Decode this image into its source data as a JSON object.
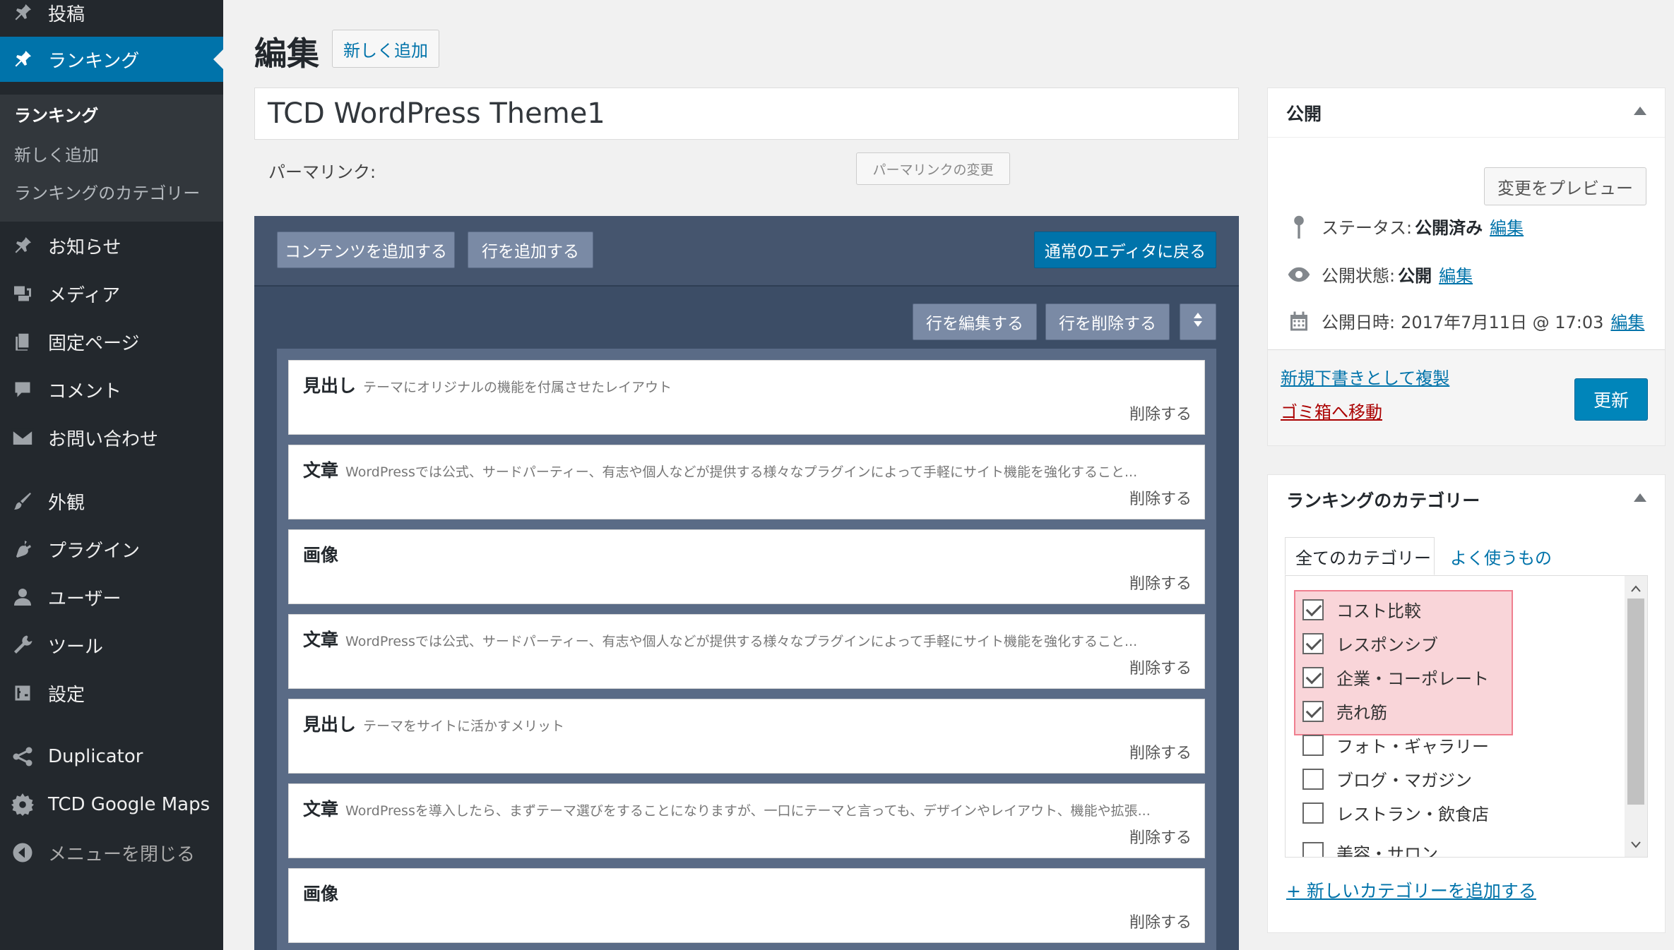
{
  "sidebar": {
    "items": [
      {
        "label": "投稿",
        "icon": "pin-icon"
      },
      {
        "label": "ランキング",
        "icon": "pin-icon"
      },
      {
        "label": "お知らせ",
        "icon": "pin-icon"
      },
      {
        "label": "メディア",
        "icon": "media-icon"
      },
      {
        "label": "固定ページ",
        "icon": "page-icon"
      },
      {
        "label": "コメント",
        "icon": "comment-icon"
      },
      {
        "label": "お問い合わせ",
        "icon": "mail-icon"
      },
      {
        "label": "外観",
        "icon": "brush-icon"
      },
      {
        "label": "プラグイン",
        "icon": "plug-icon"
      },
      {
        "label": "ユーザー",
        "icon": "user-icon"
      },
      {
        "label": "ツール",
        "icon": "wrench-icon"
      },
      {
        "label": "設定",
        "icon": "settings-icon"
      },
      {
        "label": "Duplicator",
        "icon": "share-icon"
      },
      {
        "label": "TCD Google Maps",
        "icon": "gear-icon"
      },
      {
        "label": "メニューを閉じる",
        "icon": "collapse-icon"
      }
    ],
    "submenu": [
      "ランキング",
      "新しく追加",
      "ランキングのカテゴリー"
    ]
  },
  "header": {
    "title": "編集",
    "add_new": "新しく追加"
  },
  "post": {
    "title": "TCD WordPress Theme1",
    "permalink_label": "パーマリンク:",
    "permalink_button": "パーマリンクの変更"
  },
  "builder": {
    "add_content": "コンテンツを追加する",
    "add_row": "行を追加する",
    "back_to_editor": "通常のエディタに戻る",
    "edit_row": "行を編集する",
    "delete_row": "行を削除する",
    "delete_label": "削除する",
    "rows": [
      {
        "type": "見出し",
        "desc": "テーマにオリジナルの機能を付属させたレイアウト"
      },
      {
        "type": "文章",
        "desc": "WordPressでは公式、サードパーティー、有志や個人などが提供する様々なプラグインによって手軽にサイト機能を強化すること..."
      },
      {
        "type": "画像",
        "desc": ""
      },
      {
        "type": "文章",
        "desc": "WordPressでは公式、サードパーティー、有志や個人などが提供する様々なプラグインによって手軽にサイト機能を強化すること..."
      },
      {
        "type": "見出し",
        "desc": "テーマをサイトに活かすメリット"
      },
      {
        "type": "文章",
        "desc": "WordPressを導入したら、まずテーマ選びをすることになりますが、一口にテーマと言っても、デザインやレイアウト、機能や拡張..."
      },
      {
        "type": "画像",
        "desc": ""
      }
    ]
  },
  "publish": {
    "title": "公開",
    "preview": "変更をプレビュー",
    "status_label": "ステータス:",
    "status_value": "公開済み",
    "visibility_label": "公開状態:",
    "visibility_value": "公開",
    "date_label": "公開日時:",
    "date_value": "2017年7月11日 @ 17:03",
    "edit": "編集",
    "copy_draft": "新規下書きとして複製",
    "trash": "ゴミ箱へ移動",
    "update": "更新",
    "trash_color": "#a00",
    "accent": "#0073aa"
  },
  "categories": {
    "title": "ランキングのカテゴリー",
    "tab_all": "全てのカテゴリー",
    "tab_popular": "よく使うもの",
    "items": [
      {
        "label": "コスト比較",
        "checked": true
      },
      {
        "label": "レスポンシブ",
        "checked": true
      },
      {
        "label": "企業・コーポレート",
        "checked": true
      },
      {
        "label": "売れ筋",
        "checked": true
      },
      {
        "label": "フォト・ギャラリー",
        "checked": false
      },
      {
        "label": "ブログ・マガジン",
        "checked": false
      },
      {
        "label": "レストラン・飲食店",
        "checked": false
      },
      {
        "label": "美容・サロン",
        "checked": false
      }
    ],
    "add_new": "+ 新しいカテゴリーを追加する"
  }
}
